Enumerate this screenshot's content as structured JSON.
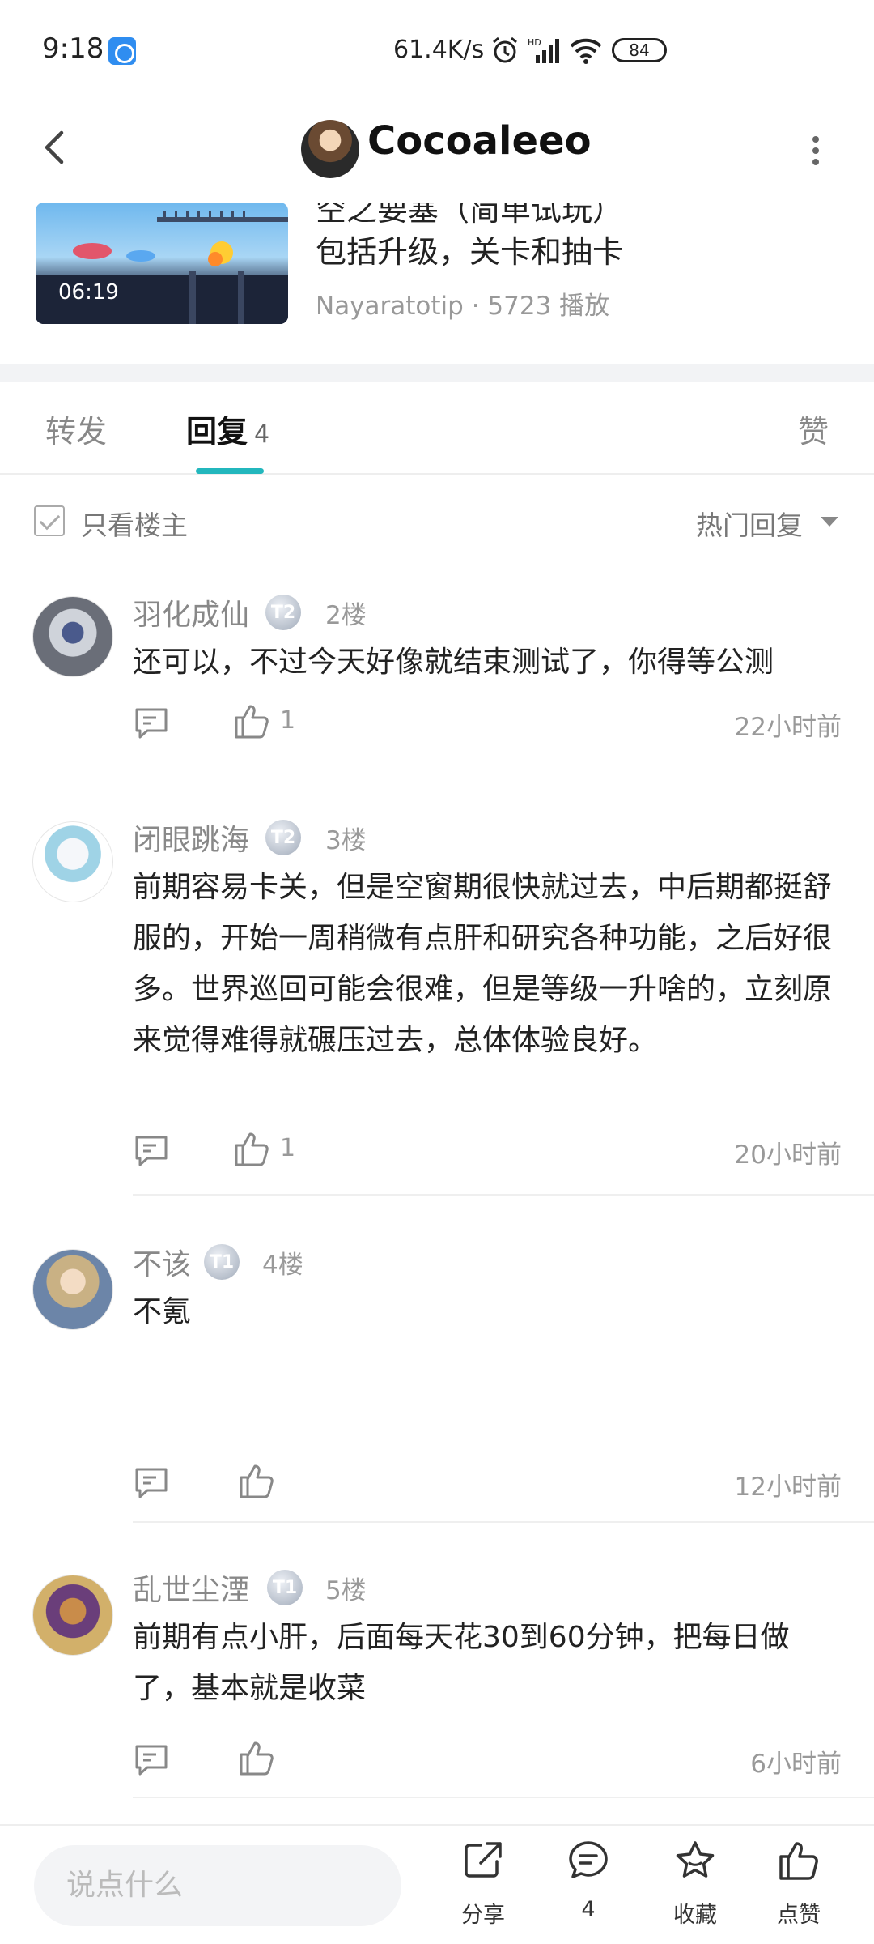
{
  "status_bar": {
    "time": "9:18",
    "speed": "61.4K/s",
    "battery": "84"
  },
  "header": {
    "title": "Cocoaleeo"
  },
  "video": {
    "duration": "06:19",
    "title_line1": "空之要塞（简单试玩）",
    "title_line2": "包括升级，关卡和抽卡",
    "author": "Nayaratotip",
    "plays": "5723 播放"
  },
  "tabs": {
    "forward": "转发",
    "reply": "回复",
    "reply_count": "4",
    "like": "赞"
  },
  "filter": {
    "only_op_label": "只看楼主",
    "sort_label": "热门回复"
  },
  "comments": [
    {
      "name": "羽化成仙",
      "badge": "T2",
      "floor": "2楼",
      "text": "还可以，不过今天好像就结束测试了，你得等公测",
      "likes": "1",
      "time": "22小时前"
    },
    {
      "name": "闭眼跳海",
      "badge": "T2",
      "floor": "3楼",
      "text": "前期容易卡关，但是空窗期很快就过去，中后期都挺舒服的，开始一周稍微有点肝和研究各种功能，之后好很多。世界巡回可能会很难，但是等级一升啥的，立刻原来觉得难得就碾压过去，总体体验良好。",
      "likes": "1",
      "time": "20小时前"
    },
    {
      "name": "不该",
      "badge": "T1",
      "floor": "4楼",
      "text": "不氪",
      "likes": "",
      "time": "12小时前"
    },
    {
      "name": "乱世尘湮",
      "badge": "T1",
      "floor": "5楼",
      "text": "前期有点小肝，后面每天花30到60分钟，把每日做了，基本就是收菜",
      "likes": "",
      "time": "6小时前"
    }
  ],
  "bottom_bar": {
    "input_placeholder": "说点什么",
    "share_label": "分享",
    "comment_count": "4",
    "favorite_label": "收藏",
    "like_label": "点赞"
  }
}
